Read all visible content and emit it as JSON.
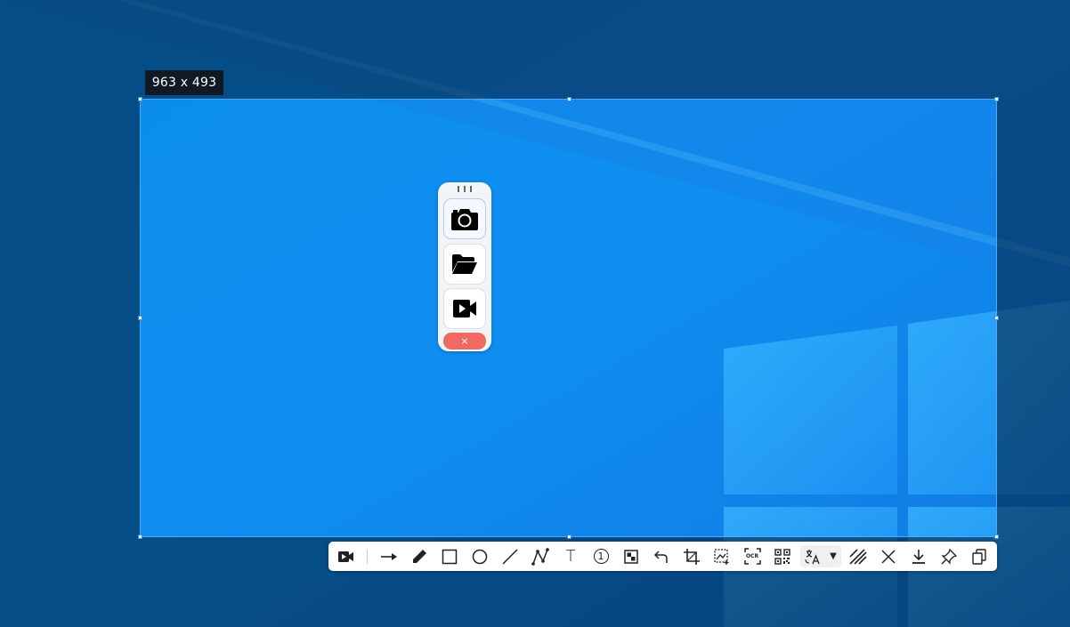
{
  "selection": {
    "size_label": "963 x 493"
  },
  "capture_panel": {
    "buttons": [
      {
        "name": "screenshot",
        "icon": "camera-icon"
      },
      {
        "name": "open-file",
        "icon": "folder-open-icon"
      },
      {
        "name": "record",
        "icon": "video-camera-icon"
      }
    ],
    "close_label": "×"
  },
  "toolbar": {
    "tools": [
      "video-record-icon",
      "arrow-icon",
      "pencil-icon",
      "rectangle-icon",
      "ellipse-icon",
      "line-icon",
      "polyline-icon",
      "text-icon",
      "number-marker-icon",
      "mosaic-icon",
      "undo-icon",
      "crop-icon",
      "image-edit-icon",
      "ocr-icon",
      "qr-code-icon",
      "translate-icon",
      "dropdown-arrow-icon",
      "hatch-icon",
      "cancel-icon",
      "download-icon",
      "pin-icon",
      "copy-icon"
    ],
    "text_tool_label": "T",
    "number_marker_label": "1",
    "ocr_label": "OCR",
    "translate_dropdown_label": "▼"
  },
  "colors": {
    "selection_border": "#4aa8ff",
    "close_button": "#f06a63",
    "desktop_bright": "#1a8ff0",
    "desktop_dark": "#0a4a78"
  }
}
